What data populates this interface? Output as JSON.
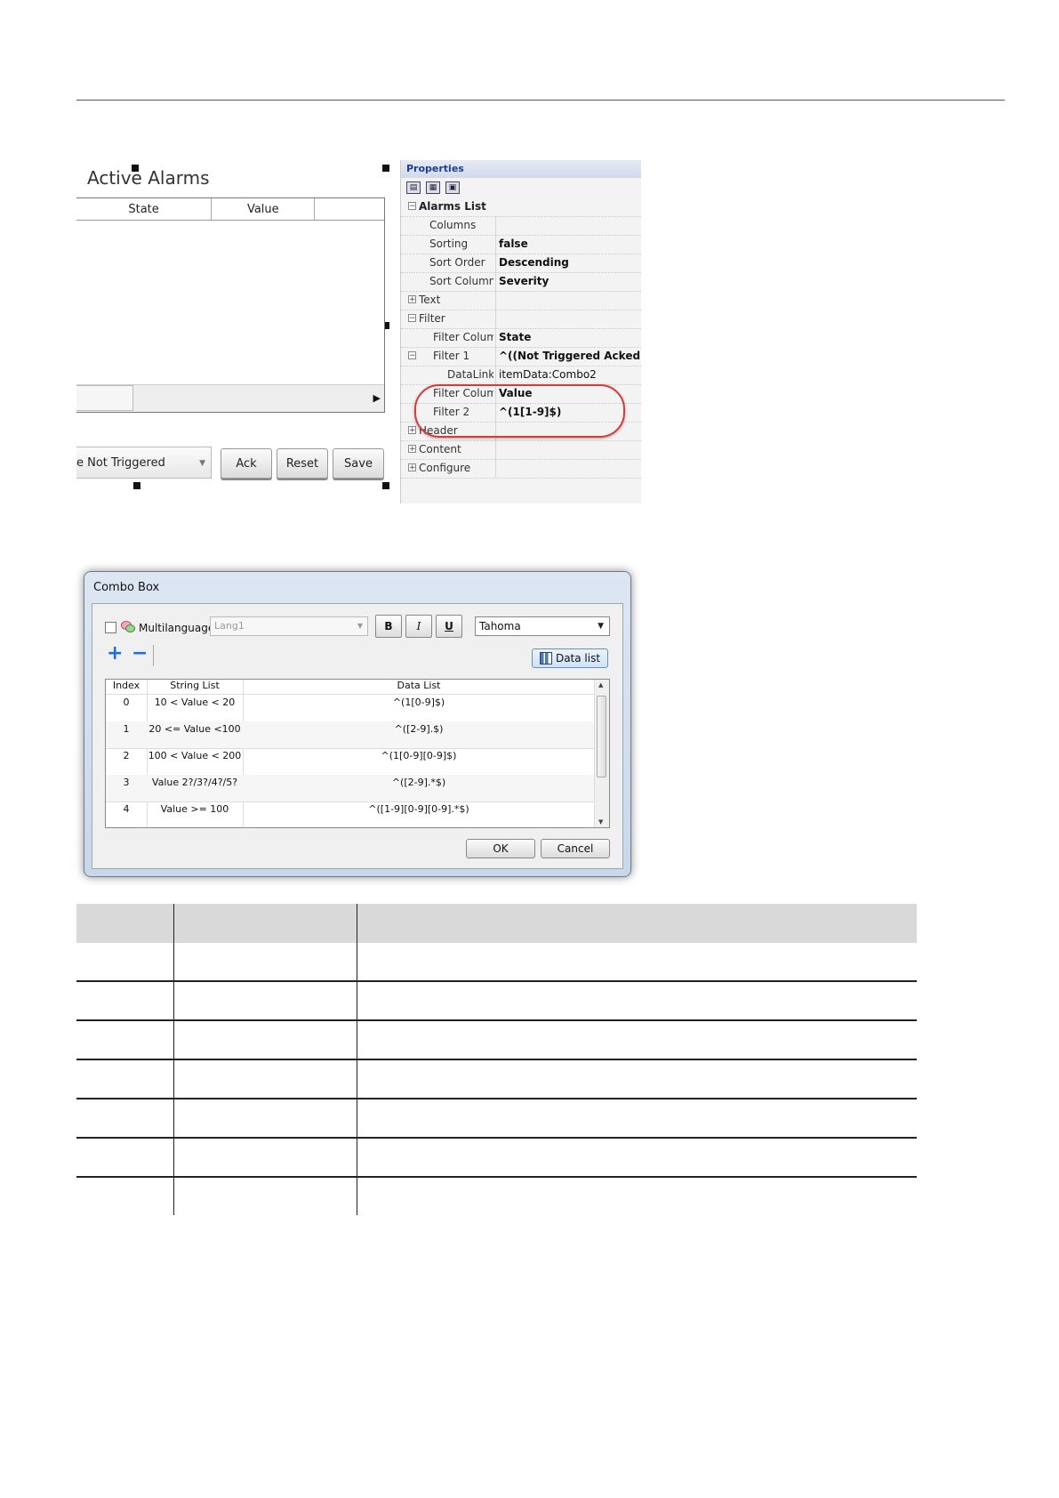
{
  "alarm_widget": {
    "title": "Active Alarms",
    "columns": [
      "State",
      "Value"
    ],
    "combo_value": "e Not Triggered",
    "buttons": {
      "ack": "Ack",
      "reset": "Reset",
      "save": "Save"
    }
  },
  "properties": {
    "title": "Properties",
    "rows": [
      {
        "name": "Alarms List",
        "value": "",
        "expander": "−",
        "kind": "category"
      },
      {
        "name": "Columns",
        "value": ""
      },
      {
        "name": "Sorting",
        "value": "false"
      },
      {
        "name": "Sort Order",
        "value": "Descending"
      },
      {
        "name": "Sort Column",
        "value": "Severity"
      },
      {
        "name": "Text",
        "value": "",
        "expander": "+"
      },
      {
        "name": "Filter",
        "value": "",
        "expander": "−"
      },
      {
        "name": "Filter Colum",
        "value": "State"
      },
      {
        "name": "Filter 1",
        "value": "^((Not Triggered Acked|N",
        "expander": "−"
      },
      {
        "name": "DataLink",
        "value": "itemData:Combo2"
      },
      {
        "name": "Filter Colum",
        "value": "Value"
      },
      {
        "name": "Filter 2",
        "value": "^(1[1-9]$)"
      },
      {
        "name": "Header",
        "value": "",
        "expander": "+"
      },
      {
        "name": "Content",
        "value": "",
        "expander": "+"
      },
      {
        "name": "Configure",
        "value": "",
        "expander": "+"
      }
    ]
  },
  "combo_dialog": {
    "title": "Combo Box",
    "multilanguage_label": "Multilanguage",
    "language": "Lang1",
    "bold": "B",
    "italic": "I",
    "underline": "U",
    "font": "Tahoma",
    "data_list_button": "Data list",
    "headers": {
      "index": "Index",
      "string_list": "String List",
      "data_list": "Data List"
    },
    "rows": [
      {
        "index": "0",
        "string": "10 < Value < 20",
        "data": "^(1[0-9]$)"
      },
      {
        "index": "1",
        "string": "20 <= Value <100",
        "data": "^([2-9].$)"
      },
      {
        "index": "2",
        "string": "100 < Value < 200",
        "data": "^(1[0-9][0-9]$)"
      },
      {
        "index": "3",
        "string": "Value 2?/3?/4?/5?",
        "data": "^([2-9].*$)"
      },
      {
        "index": "4",
        "string": "Value >= 100",
        "data": "^([1-9][0-9][0-9].*$)"
      }
    ],
    "ok": "OK",
    "cancel": "Cancel"
  }
}
